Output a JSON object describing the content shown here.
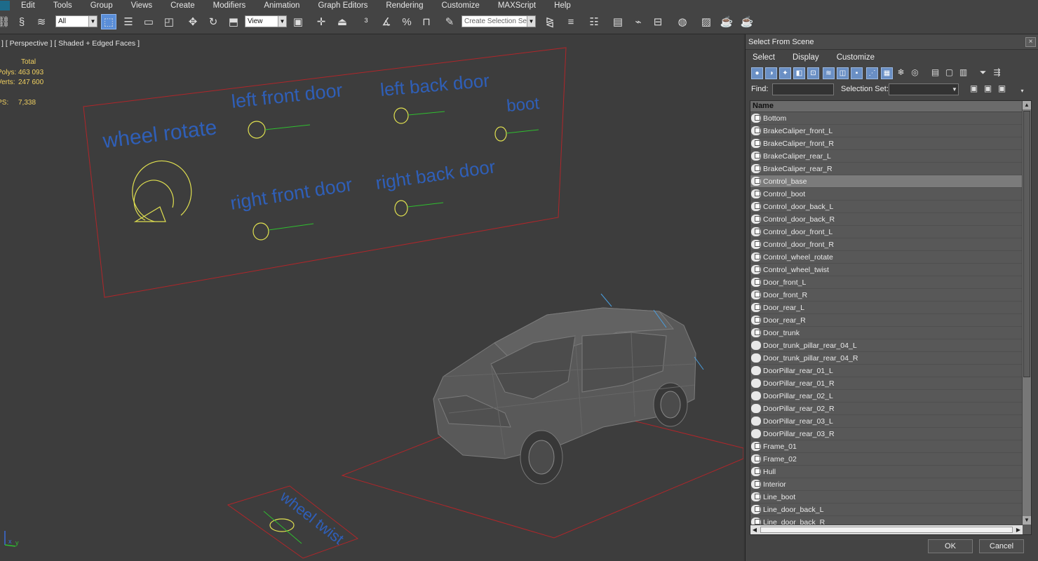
{
  "menubar": {
    "items": [
      "Edit",
      "Tools",
      "Group",
      "Views",
      "Create",
      "Modifiers",
      "Animation",
      "Graph Editors",
      "Rendering",
      "Customize",
      "MAXScript",
      "Help"
    ]
  },
  "toolbar": {
    "filter_value": "All",
    "coord_value": "View",
    "selection_set_placeholder": "Create Selection Se"
  },
  "viewport": {
    "label": "] [ Perspective ] [ Shaded + Edged Faces ]",
    "stats": {
      "total_label": "Total",
      "polys_label": "Polys:",
      "polys_value": "463 093",
      "verts_label": "Verts:",
      "verts_value": "247 600",
      "fps_label": "FPS:",
      "fps_value": "7,338"
    },
    "control_labels": {
      "wheel_rotate": "wheel rotate",
      "left_front_door": "left front door",
      "left_back_door": "left back door",
      "boot": "boot",
      "right_front_door": "right front door",
      "right_back_door": "right back door",
      "wheel_twist": "wheel twist"
    },
    "axis": {
      "x": "x",
      "y": "y"
    },
    "colors": {
      "panel_outline": "#b0262a",
      "control_text": "#2f5fb8",
      "control_circle": "#e0e050",
      "control_line": "#2fbf2f"
    }
  },
  "dialog": {
    "title": "Select From Scene",
    "close": "×",
    "menu": [
      "Select",
      "Display",
      "Customize"
    ],
    "find_label": "Find:",
    "find_value": "",
    "selection_set_label": "Selection Set:",
    "column_header": "Name",
    "items": [
      {
        "name": "Bottom",
        "group": true
      },
      {
        "name": "BrakeCaliper_front_L",
        "group": true
      },
      {
        "name": "BrakeCaliper_front_R",
        "group": true
      },
      {
        "name": "BrakeCaliper_rear_L",
        "group": true
      },
      {
        "name": "BrakeCaliper_rear_R",
        "group": true
      },
      {
        "name": "Control_base",
        "group": true,
        "selected": true
      },
      {
        "name": "Control_boot",
        "group": true
      },
      {
        "name": "Control_door_back_L",
        "group": true
      },
      {
        "name": "Control_door_back_R",
        "group": true
      },
      {
        "name": "Control_door_front_L",
        "group": true
      },
      {
        "name": "Control_door_front_R",
        "group": true
      },
      {
        "name": "Control_wheel_rotate",
        "group": true
      },
      {
        "name": "Control_wheel_twist",
        "group": true
      },
      {
        "name": "Door_front_L",
        "group": true
      },
      {
        "name": "Door_front_R",
        "group": true
      },
      {
        "name": "Door_rear_L",
        "group": true
      },
      {
        "name": "Door_rear_R",
        "group": true
      },
      {
        "name": "Door_trunk",
        "group": true
      },
      {
        "name": "Door_trunk_pillar_rear_04_L",
        "group": false
      },
      {
        "name": "Door_trunk_pillar_rear_04_R",
        "group": false
      },
      {
        "name": "DoorPillar_rear_01_L",
        "group": false
      },
      {
        "name": "DoorPillar_rear_01_R",
        "group": false
      },
      {
        "name": "DoorPillar_rear_02_L",
        "group": false
      },
      {
        "name": "DoorPillar_rear_02_R",
        "group": false
      },
      {
        "name": "DoorPillar_rear_03_L",
        "group": false
      },
      {
        "name": "DoorPillar_rear_03_R",
        "group": false
      },
      {
        "name": "Frame_01",
        "group": true
      },
      {
        "name": "Frame_02",
        "group": true
      },
      {
        "name": "Hull",
        "group": true
      },
      {
        "name": "Interior",
        "group": true
      },
      {
        "name": "Line_boot",
        "group": true
      },
      {
        "name": "Line_door_back_L",
        "group": true
      },
      {
        "name": "Line_door_back_R",
        "group": true
      }
    ],
    "ok_label": "OK",
    "cancel_label": "Cancel"
  }
}
